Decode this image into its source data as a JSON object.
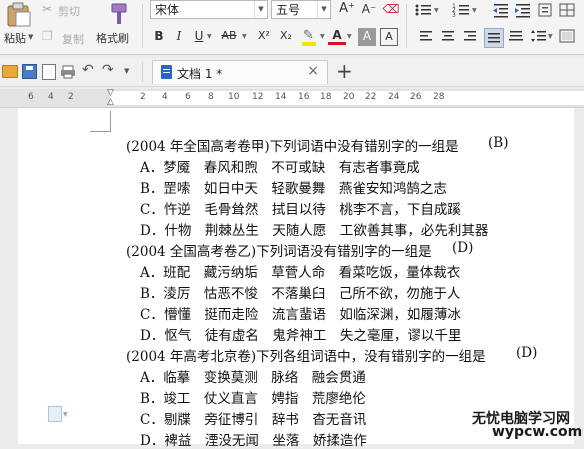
{
  "ribbon": {
    "cut_label": "剪切",
    "paste_label": "粘贴",
    "copy_label": "复制",
    "format_painter_label": "格式刷",
    "font_name": "宋体",
    "font_size": "五号",
    "bold_label": "B",
    "italic_label": "I",
    "underline_label": "U",
    "strike_label": "AB",
    "superscript_label": "X²",
    "subscript_label": "X₂",
    "font_color_label": "A",
    "char_shading_label": "A",
    "char_border_label": "A",
    "grow_font_label": "A⁺",
    "shrink_font_label": "A⁻",
    "clear_format_label": "⌫"
  },
  "tab": {
    "title": "文档 1 *",
    "close_label": "×",
    "new_tab_label": "+"
  },
  "ruler": {
    "ticks": [
      "6",
      "4",
      "2",
      "2",
      "4",
      "6",
      "8",
      "10",
      "12",
      "14",
      "16",
      "18",
      "20",
      "22",
      "24",
      "26",
      "28"
    ]
  },
  "document": {
    "q1": {
      "question": "(2004 年全国高考卷甲)下列词语中没有错别字的一组是",
      "answer": "(B)",
      "options": [
        "A．梦魇　春风和煦　不可或缺　有志者事竟成",
        "B．罡嗦　如日中天　轻歌曼舞　燕雀安知鸿鹄之志",
        "C．忤逆　毛骨耸然　拭目以待　桃李不言，下自成蹊",
        "D．什物　荆棘丛生　天随人愿　工欲善其事，必先利其器"
      ]
    },
    "q2": {
      "question": "(2004 全国高考卷乙)下列词语没有错别字的一组是",
      "answer": "(D)",
      "options": [
        "A．班配　藏污纳垢　草菅人命　看菜吃饭，量体裁衣",
        "B．淩厉　怙恶不悛　不落巢臼　己所不欲，勿施于人",
        "C．懵懂　挺而走险　流言蜚语　如临深渊，如履薄冰",
        "D．怄气　徒有虚名　鬼斧神工　失之毫厘，谬以千里"
      ]
    },
    "q3": {
      "question": "(2004 年高考北京卷)下列各组词语中，没有错别字的一组是",
      "answer": "(D)",
      "options": [
        "A．临摹　变换莫测　脉络　融会贯通",
        "B．竣工　仗义直言　娉指　荒廖绝伦",
        "C．剔牒　旁征博引　辞书　杳无音讯",
        "D．裨益　湮没无闻　坐落　娇揉造作"
      ]
    }
  },
  "watermark": {
    "title": "无忧电脑学习网",
    "url": "wypcw.com"
  }
}
